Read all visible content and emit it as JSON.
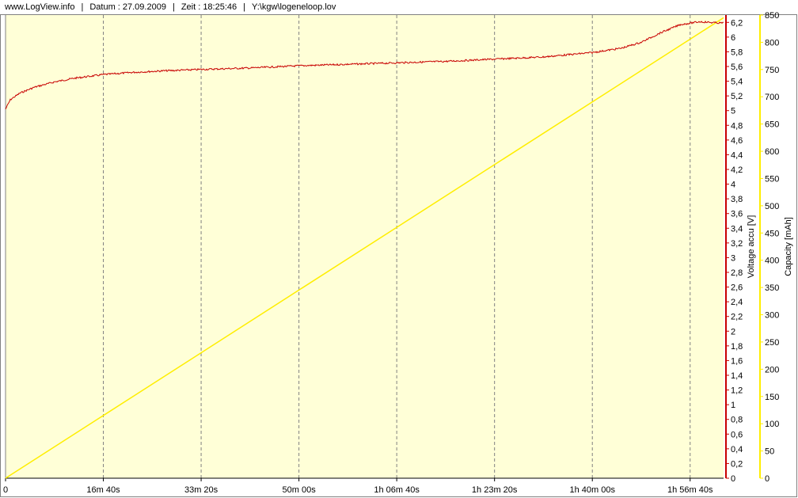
{
  "header": {
    "site": "www.LogView.info",
    "datum": "Datum : 27.09.2009",
    "zeit": "Zeit : 18:25:46",
    "file": "Y:\\kgw\\logeneloop.lov"
  },
  "colors": {
    "plot_bg": "#ffffd7",
    "voltage": "#c80000",
    "capacity": "#ffee00",
    "grid": "#808080"
  },
  "chart_data": {
    "type": "line",
    "grid": true,
    "x_axis": {
      "unit": "seconds",
      "range": [
        0,
        7342
      ],
      "ticks": [
        {
          "value": 0,
          "label": "0"
        },
        {
          "value": 1000,
          "label": "16m 40s"
        },
        {
          "value": 2000,
          "label": "33m 20s"
        },
        {
          "value": 3000,
          "label": "50m 00s"
        },
        {
          "value": 4000,
          "label": "1h 06m 40s"
        },
        {
          "value": 5000,
          "label": "1h 23m 20s"
        },
        {
          "value": 6000,
          "label": "1h 40m 00s"
        },
        {
          "value": 7000,
          "label": "1h 56m 40s"
        }
      ]
    },
    "y_axes": [
      {
        "id": "voltage",
        "label": "Voltage accu [V]",
        "range": [
          0,
          6.3
        ],
        "ticks": [
          "0",
          "0,2",
          "0,4",
          "0,6",
          "0,8",
          "1",
          "1,2",
          "1,4",
          "1,6",
          "1,8",
          "2",
          "2,2",
          "2,4",
          "2,6",
          "2,8",
          "3",
          "3,2",
          "3,4",
          "3,6",
          "3,8",
          "4",
          "4,2",
          "4,4",
          "4,6",
          "4,8",
          "5",
          "5,2",
          "5,4",
          "5,6",
          "5,8",
          "6",
          "6,2"
        ],
        "tick_values": [
          0,
          0.2,
          0.4,
          0.6,
          0.8,
          1,
          1.2,
          1.4,
          1.6,
          1.8,
          2,
          2.2,
          2.4,
          2.6,
          2.8,
          3,
          3.2,
          3.4,
          3.6,
          3.8,
          4,
          4.2,
          4.4,
          4.6,
          4.8,
          5,
          5.2,
          5.4,
          5.6,
          5.8,
          6,
          6.2
        ]
      },
      {
        "id": "capacity",
        "label": "Capacity [mAh]",
        "range": [
          0,
          850
        ],
        "ticks": [
          "0",
          "50",
          "100",
          "150",
          "200",
          "250",
          "300",
          "350",
          "400",
          "450",
          "500",
          "550",
          "600",
          "650",
          "700",
          "750",
          "800",
          "850"
        ],
        "tick_values": [
          0,
          50,
          100,
          150,
          200,
          250,
          300,
          350,
          400,
          450,
          500,
          550,
          600,
          650,
          700,
          750,
          800,
          850
        ]
      }
    ],
    "series": [
      {
        "id": "voltage",
        "axis": "voltage",
        "x": [
          0,
          50,
          150,
          300,
          500,
          700,
          1000,
          1300,
          1600,
          2000,
          2500,
          3000,
          3500,
          4000,
          4500,
          5000,
          5500,
          6000,
          6300,
          6500,
          6700,
          6900,
          7100,
          7200,
          7342
        ],
        "y": [
          5.02,
          5.15,
          5.24,
          5.32,
          5.39,
          5.44,
          5.49,
          5.52,
          5.54,
          5.56,
          5.58,
          5.61,
          5.63,
          5.65,
          5.67,
          5.7,
          5.73,
          5.79,
          5.85,
          5.93,
          6.06,
          6.17,
          6.21,
          6.2,
          6.19
        ]
      },
      {
        "id": "capacity",
        "axis": "capacity",
        "x": [
          0,
          7342
        ],
        "y": [
          0,
          845
        ]
      }
    ]
  }
}
